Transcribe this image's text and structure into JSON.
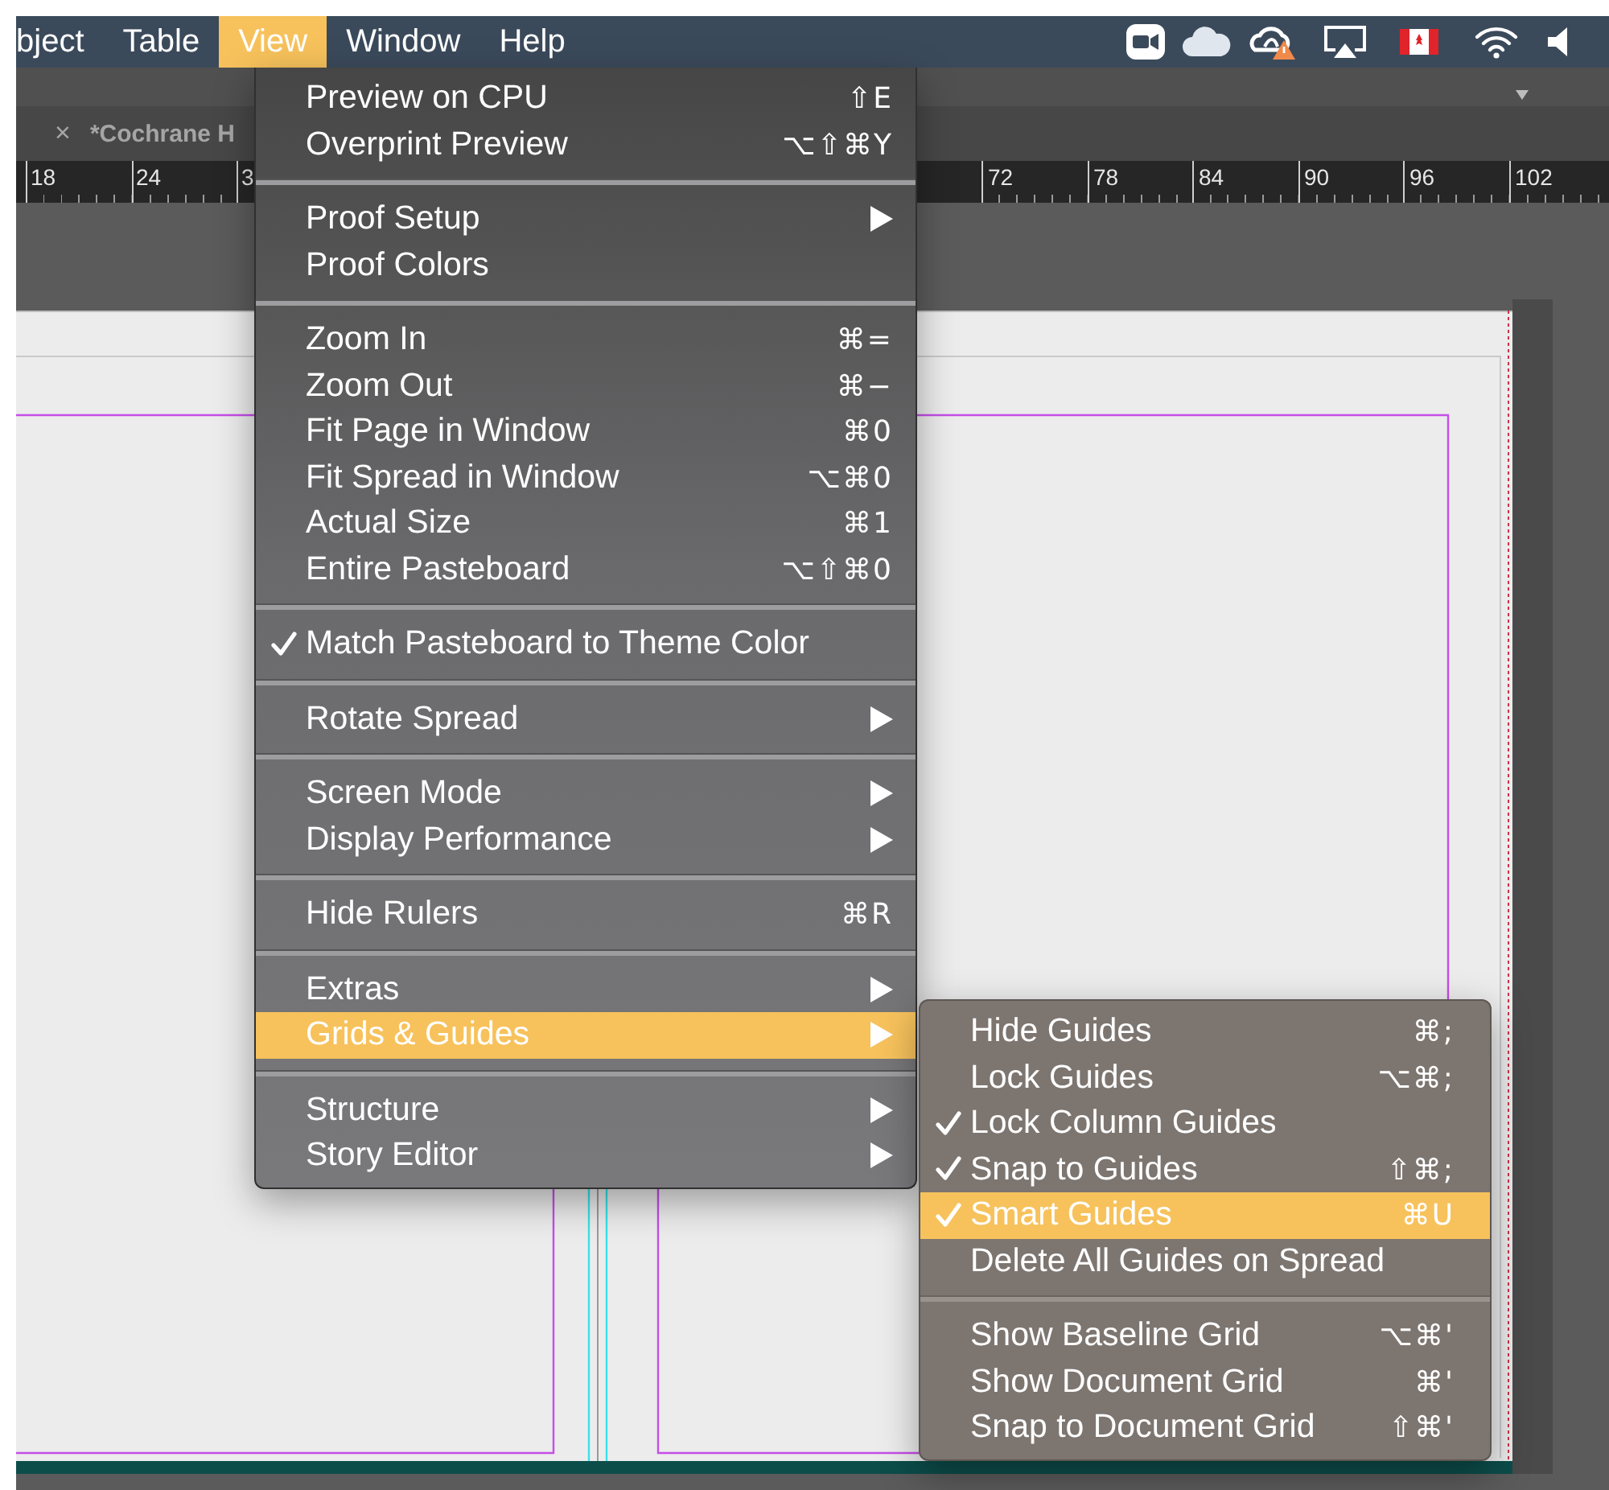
{
  "menu_bar": {
    "items": [
      {
        "label": "bject",
        "selected": false
      },
      {
        "label": "Table",
        "selected": false
      },
      {
        "label": "View",
        "selected": true
      },
      {
        "label": "Window",
        "selected": false
      },
      {
        "label": "Help",
        "selected": false
      }
    ]
  },
  "document_tab": {
    "close": "×",
    "title": "*Cochrane H"
  },
  "ruler": {
    "left_labels": [
      "18",
      "24",
      "3"
    ],
    "right_labels": [
      "72",
      "78",
      "84",
      "90",
      "96",
      "102"
    ]
  },
  "view_menu": {
    "sections": [
      [
        {
          "label": "Preview on CPU",
          "shortcut": "⇧E",
          "checked": false,
          "submenu": false,
          "selected": false
        },
        {
          "label": "Overprint Preview",
          "shortcut": "⌥⇧⌘Y",
          "checked": false,
          "submenu": false,
          "selected": false
        }
      ],
      [
        {
          "label": "Proof Setup",
          "checked": false,
          "submenu": true,
          "selected": false
        },
        {
          "label": "Proof Colors",
          "checked": false,
          "submenu": false,
          "selected": false
        }
      ],
      [
        {
          "label": "Zoom In",
          "shortcut": "⌘=",
          "checked": false,
          "submenu": false,
          "selected": false
        },
        {
          "label": "Zoom Out",
          "shortcut": "⌘−",
          "checked": false,
          "submenu": false,
          "selected": false
        },
        {
          "label": "Fit Page in Window",
          "shortcut": "⌘0",
          "checked": false,
          "submenu": false,
          "selected": false
        },
        {
          "label": "Fit Spread in Window",
          "shortcut": "⌥⌘0",
          "checked": false,
          "submenu": false,
          "selected": false
        },
        {
          "label": "Actual Size",
          "shortcut": "⌘1",
          "checked": false,
          "submenu": false,
          "selected": false
        },
        {
          "label": "Entire Pasteboard",
          "shortcut": "⌥⇧⌘0",
          "checked": false,
          "submenu": false,
          "selected": false
        }
      ],
      [
        {
          "label": "Match Pasteboard to Theme Color",
          "checked": true,
          "submenu": false,
          "selected": false
        }
      ],
      [
        {
          "label": "Rotate Spread",
          "checked": false,
          "submenu": true,
          "selected": false
        }
      ],
      [
        {
          "label": "Screen Mode",
          "checked": false,
          "submenu": true,
          "selected": false
        },
        {
          "label": "Display Performance",
          "checked": false,
          "submenu": true,
          "selected": false
        }
      ],
      [
        {
          "label": "Hide Rulers",
          "shortcut": "⌘R",
          "checked": false,
          "submenu": false,
          "selected": false
        }
      ],
      [
        {
          "label": "Extras",
          "checked": false,
          "submenu": true,
          "selected": false
        },
        {
          "label": "Grids & Guides",
          "checked": false,
          "submenu": true,
          "selected": true
        }
      ],
      [
        {
          "label": "Structure",
          "checked": false,
          "submenu": true,
          "selected": false
        },
        {
          "label": "Story Editor",
          "checked": false,
          "submenu": true,
          "selected": false
        }
      ]
    ]
  },
  "grids_guides_submenu": {
    "sections": [
      [
        {
          "label": "Hide Guides",
          "shortcut": "⌘;",
          "checked": false,
          "selected": false
        },
        {
          "label": "Lock Guides",
          "shortcut": "⌥⌘;",
          "checked": false,
          "selected": false
        },
        {
          "label": "Lock Column Guides",
          "checked": true,
          "selected": false
        },
        {
          "label": "Snap to Guides",
          "shortcut": "⇧⌘;",
          "checked": true,
          "selected": false
        },
        {
          "label": "Smart Guides",
          "shortcut": "⌘U",
          "checked": true,
          "selected": true
        },
        {
          "label": "Delete All Guides on Spread",
          "checked": false,
          "selected": false
        }
      ],
      [
        {
          "label": "Show Baseline Grid",
          "shortcut": "⌥⌘'",
          "checked": false,
          "selected": false
        },
        {
          "label": "Show Document Grid",
          "shortcut": "⌘'",
          "checked": false,
          "selected": false
        },
        {
          "label": "Snap to Document Grid",
          "shortcut": "⇧⌘'",
          "checked": false,
          "selected": false
        }
      ]
    ]
  }
}
